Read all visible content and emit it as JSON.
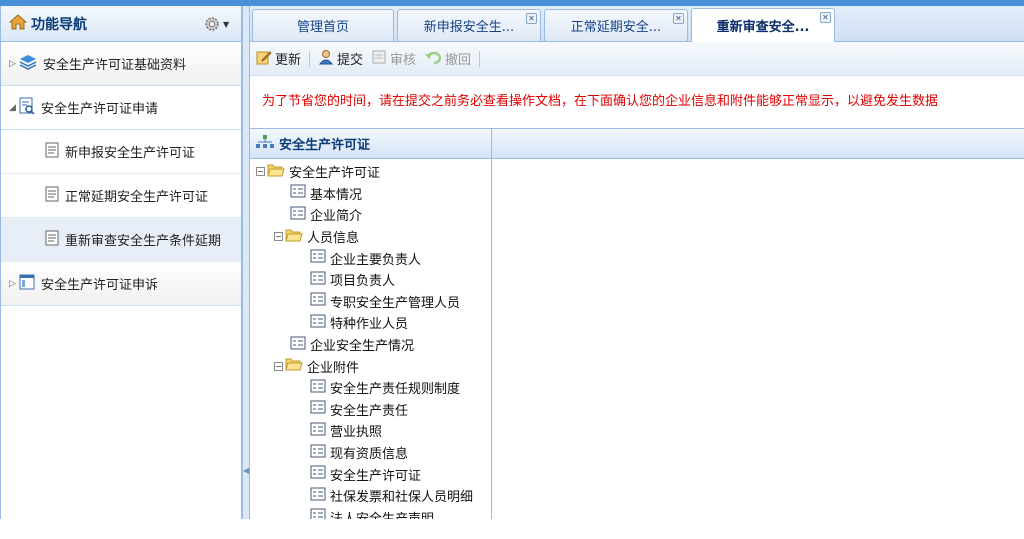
{
  "sidebar": {
    "title": "功能导航",
    "groups": [
      {
        "label": "安全生产许可证基础资料"
      },
      {
        "label": "安全生产许可证申请"
      },
      {
        "label": "安全生产许可证申诉"
      }
    ],
    "items": [
      {
        "label": "新申报安全生产许可证"
      },
      {
        "label": "正常延期安全生产许可证"
      },
      {
        "label": "重新审查安全生产条件延期"
      }
    ]
  },
  "tabs": [
    {
      "label": "管理首页"
    },
    {
      "label": "新申报安全生..."
    },
    {
      "label": "正常延期安全..."
    },
    {
      "label": "重新审查安全..."
    }
  ],
  "toolbar": {
    "update_label": "更新",
    "submit_label": "提交",
    "review_label": "审核",
    "revoke_label": "撤回"
  },
  "notice": "为了节省您的时间，请在提交之前务必查看操作文档，在下面确认您的企业信息和附件能够正常显示，以避免发生数据",
  "tree": {
    "title": "安全生产许可证",
    "root": "安全生产许可证",
    "basic_info": "基本情况",
    "company_intro": "企业简介",
    "personnel": "人员信息",
    "personnel_items": [
      "企业主要负责人",
      "项目负责人",
      "专职安全生产管理人员",
      "特种作业人员"
    ],
    "safety_status": "企业安全生产情况",
    "attachments": "企业附件",
    "attachment_items": [
      "安全生产责任规则制度",
      "安全生产责任",
      "营业执照",
      "现有资质信息",
      "安全生产许可证",
      "社保发票和社保人员明细",
      "法人安全生产声明"
    ]
  },
  "colors": {
    "accent": "#99bbe8",
    "notice": "#e00000",
    "title": "#0b3b78"
  }
}
